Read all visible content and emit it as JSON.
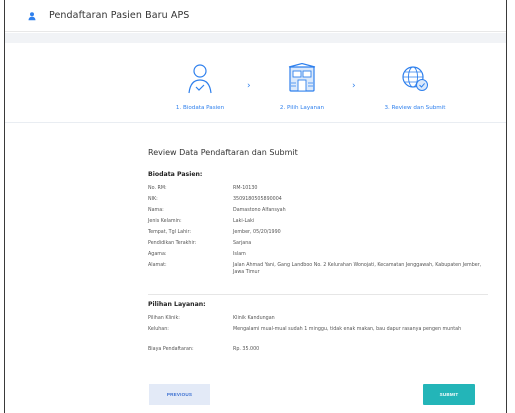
{
  "header": {
    "title": "Pendaftaran Pasien Baru APS",
    "icon": "user-icon"
  },
  "steps": [
    {
      "label": "1. Biodata Pasien",
      "icon": "person-check-icon"
    },
    {
      "label": "2. Pilih Layanan",
      "icon": "hospital-clinic-icon"
    },
    {
      "label": "3. Review dan Submit",
      "icon": "globe-check-icon"
    }
  ],
  "review": {
    "heading": "Review Data Pendaftaran dan Submit",
    "biodata_title": "Biodata Pasien:",
    "biodata": [
      {
        "k": "No. RM:",
        "v": "RM-10130"
      },
      {
        "k": "NIK:",
        "v": "3509180505890004"
      },
      {
        "k": "Nama:",
        "v": "Damastono Alfansyah"
      },
      {
        "k": "Jenis Kelamin:",
        "v": "Laki-Laki"
      },
      {
        "k": "Tempat, Tgl Lahir:",
        "v": "Jember, 05/20/1990"
      },
      {
        "k": "Pendidikan Terakhir:",
        "v": "Sarjana"
      },
      {
        "k": "Agama:",
        "v": "Islam"
      },
      {
        "k": "Alamat:",
        "v": "Jalan Ahmad Yani, Gang Landboo No. 2 Kelurahan Wonojati, Kecamatan Jenggawah, Kabupaten Jember, Jawa Timur"
      }
    ],
    "layanan_title": "Pilihan Layanan:",
    "layanan": [
      {
        "k": "Pilihan Klinik:",
        "v": "Klinik Kandungan"
      },
      {
        "k": "Keluhan:",
        "v": "Mengalami mual-mual sudah 1 minggu, tidak enak makan, bau dapur rasanya pengen muntah"
      },
      {
        "k": "Biaya Pendaftaran:",
        "v": "Rp. 35.000"
      }
    ]
  },
  "buttons": {
    "previous": "PREVIOUS",
    "submit": "SUBMIT"
  },
  "colors": {
    "accent": "#2f80ed",
    "submit": "#23b5b8",
    "previous_bg": "#e3eaf7"
  }
}
